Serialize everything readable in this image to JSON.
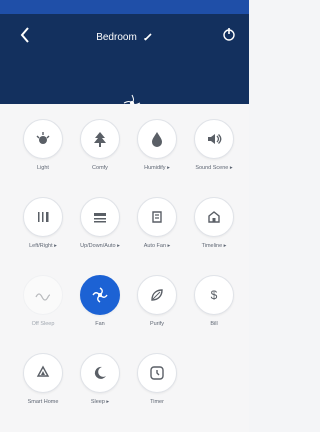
{
  "header": {
    "title": "Bedroom"
  },
  "controls": [
    {
      "label": "Light",
      "icon": "light-icon"
    },
    {
      "label": "Comfy",
      "icon": "tree-icon"
    },
    {
      "label": "Humidify ▸",
      "icon": "drop-icon"
    },
    {
      "label": "Sound Scene ▸",
      "icon": "speaker-icon"
    },
    {
      "label": "Left/Right ▸",
      "icon": "left-right-icon"
    },
    {
      "label": "Up/Down/Auto ▸",
      "icon": "up-down-icon"
    },
    {
      "label": "Auto Fan ▸",
      "icon": "fan-frame-icon"
    },
    {
      "label": "Timeline ▸",
      "icon": "home-icon"
    },
    {
      "label": "Off Sleep",
      "icon": "wave-icon",
      "muted": true
    },
    {
      "label": "Fan",
      "icon": "fan-icon",
      "active": true
    },
    {
      "label": "Purify",
      "icon": "leaf-icon"
    },
    {
      "label": "Bill",
      "icon": "dollar-icon"
    },
    {
      "label": "Smart Home",
      "icon": "recycle-icon"
    },
    {
      "label": "Sleep ▸",
      "icon": "moon-icon"
    },
    {
      "label": "Timer",
      "icon": "clock-icon"
    }
  ],
  "colors": {
    "header": "#13305e",
    "status_bar": "#1f4fa8",
    "active": "#1c62d4"
  }
}
